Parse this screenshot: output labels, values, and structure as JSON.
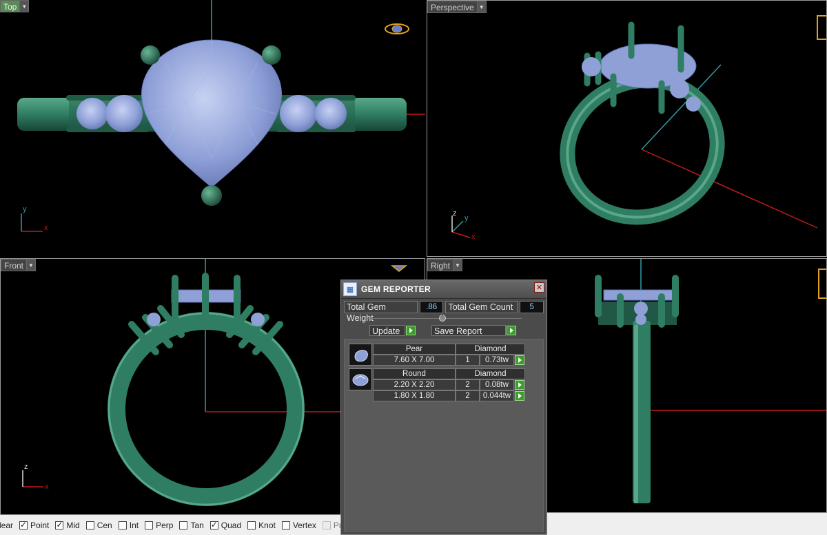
{
  "viewports": {
    "top": {
      "title": "Top",
      "axis_x": "x",
      "axis_y": "y"
    },
    "perspective": {
      "title": "Perspective",
      "axis_x": "x",
      "axis_y": "y",
      "axis_z": "z"
    },
    "front": {
      "title": "Front",
      "axis_x": "x",
      "axis_z": "z"
    },
    "right": {
      "title": "Right"
    }
  },
  "gem_reporter": {
    "title": "GEM REPORTER",
    "close": "✕",
    "total_weight_label": "Total Gem Weight",
    "total_weight_value": ".86",
    "total_count_label": "Total Gem Count",
    "total_count_value": "5",
    "update_label": "Update",
    "save_label": "Save Report",
    "groups": [
      {
        "shape": "Pear",
        "material": "Diamond",
        "rows": [
          {
            "size": "7.60 X 7.00",
            "count": "1",
            "weight": "0.73tw"
          }
        ]
      },
      {
        "shape": "Round",
        "material": "Diamond",
        "rows": [
          {
            "size": "2.20 X 2.20",
            "count": "2",
            "weight": "0.08tw"
          },
          {
            "size": "1.80 X 1.80",
            "count": "2",
            "weight": "0.044tw"
          }
        ]
      }
    ]
  },
  "statusbar": {
    "items": [
      {
        "label": "lear",
        "checked": null
      },
      {
        "label": "Point",
        "checked": true
      },
      {
        "label": "Mid",
        "checked": true
      },
      {
        "label": "Cen",
        "checked": false
      },
      {
        "label": "Int",
        "checked": false
      },
      {
        "label": "Perp",
        "checked": false
      },
      {
        "label": "Tan",
        "checked": false
      },
      {
        "label": "Quad",
        "checked": true
      },
      {
        "label": "Knot",
        "checked": false
      },
      {
        "label": "Vertex",
        "checked": false
      },
      {
        "label": "Project",
        "checked": false,
        "disabled": true
      }
    ]
  },
  "colors": {
    "metal": "#2f7d62",
    "metal_dark": "#1c4f3d",
    "metal_light": "#56a888",
    "gem": "#8ea0d6",
    "gem_light": "#c3cdf0",
    "axis_x": "#c21a1a",
    "axis_y": "#2aa0a8",
    "active_title": "#5a8a57"
  }
}
